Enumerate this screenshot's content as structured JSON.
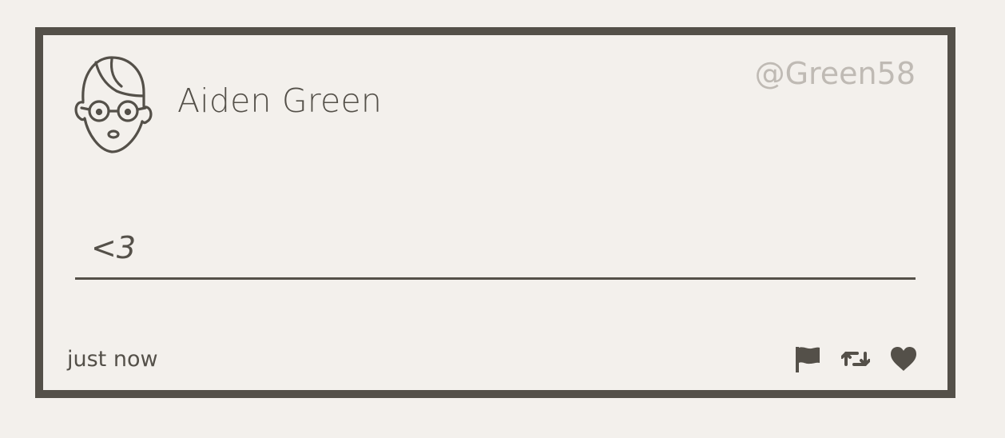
{
  "tweet": {
    "user_name": "Aiden Green",
    "handle": "@Green58",
    "message": "<3",
    "timestamp": "just now"
  },
  "icons": {
    "avatar": "avatar-icon",
    "flag": "flag-icon",
    "retweet": "retweet-icon",
    "like": "heart-icon"
  },
  "colors": {
    "background": "#f3f0ec",
    "border": "#545049",
    "text": "#545049",
    "handle": "#bfbab4"
  }
}
